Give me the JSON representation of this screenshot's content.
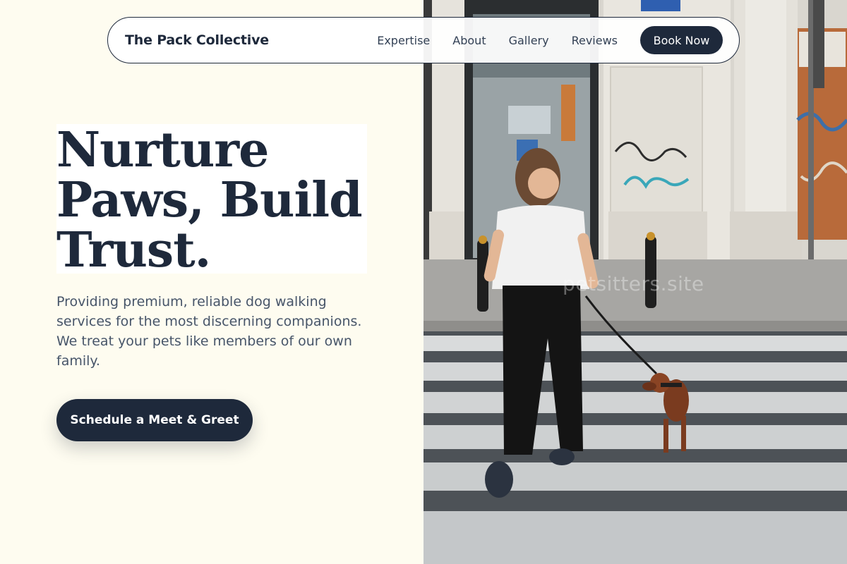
{
  "nav": {
    "brand": "The Pack Collective",
    "links": [
      "Expertise",
      "About",
      "Gallery",
      "Reviews"
    ],
    "cta_label": "Book Now"
  },
  "hero": {
    "title_lines": [
      "Nurture",
      "Paws, Build",
      "Trust."
    ],
    "subtitle_lines": [
      "Providing premium, reliable dog walking",
      "services for the most discerning companions.",
      "We treat your pets like members of our own",
      "family."
    ],
    "cta_label": "Schedule a Meet & Greet"
  },
  "photo": {
    "watermark": "petsitters.site"
  },
  "colors": {
    "background": "#fefcf0",
    "primary": "#1e293b",
    "text_muted": "#475569"
  }
}
